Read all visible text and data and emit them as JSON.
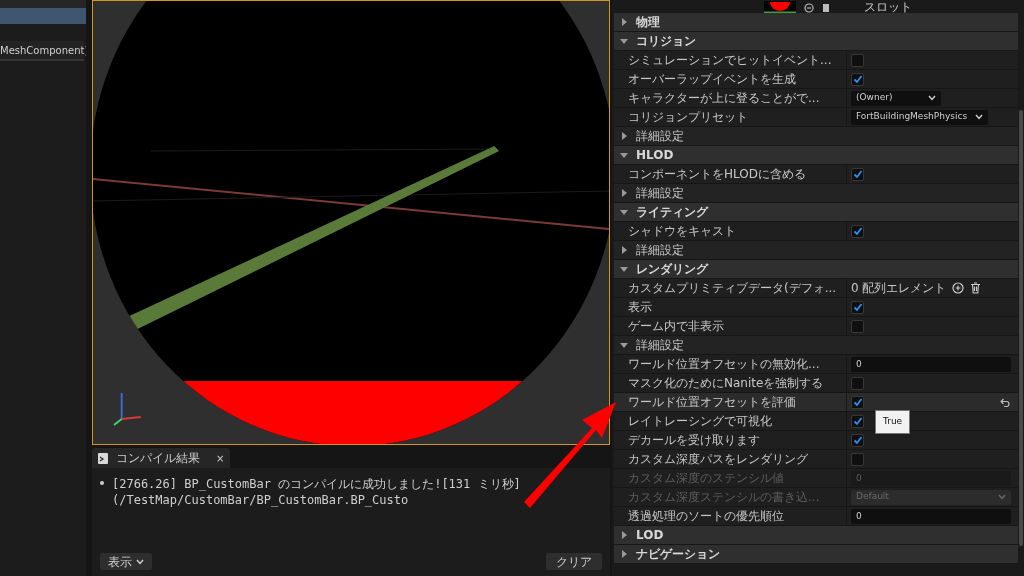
{
  "left_panel": {
    "selected_row": {
      "selected": true
    },
    "item": "MeshComponent)"
  },
  "compile_results": {
    "tab": "コンパイル結果",
    "close": "×",
    "log": [
      "[2766.26] BP_CustomBar のコンパイルに成功しました![131 ミリ秒] (/TestMap/CustomBar/BP_CustomBar.BP_Custo"
    ],
    "show_button": "表示",
    "clear_button": "クリア"
  },
  "details": {
    "slot_label": "スロット",
    "sections": [
      {
        "label": "物理",
        "expanded": false
      },
      {
        "label": "コリジョン",
        "expanded": true,
        "children": [
          {
            "kind": "checkbox",
            "label": "シミュレーションでヒットイベント...",
            "checked": false,
            "hovered": false
          },
          {
            "kind": "checkbox",
            "label": "オーバーラップイベントを生成",
            "checked": true,
            "hovered": false
          },
          {
            "kind": "dropdown",
            "label": "キャラクターが上に登ることがで...",
            "value": "(Owner)",
            "hovered": false
          },
          {
            "kind": "dropdown",
            "label": "コリジョンプリセット",
            "value": "FortBuildingMeshPhysics",
            "hovered": false
          },
          {
            "kind": "group",
            "label": "詳細設定",
            "expanded": false
          }
        ]
      },
      {
        "label": "HLOD",
        "expanded": true,
        "children": [
          {
            "kind": "checkbox",
            "label": "コンポーネントをHLODに含める",
            "checked": true,
            "hovered": false
          },
          {
            "kind": "group",
            "label": "詳細設定",
            "expanded": false
          }
        ]
      },
      {
        "label": "ライティング",
        "expanded": true,
        "children": [
          {
            "kind": "checkbox",
            "label": "シャドウをキャスト",
            "checked": true,
            "hovered": false
          },
          {
            "kind": "group",
            "label": "詳細設定",
            "expanded": false
          }
        ]
      },
      {
        "label": "レンダリング",
        "expanded": true,
        "children": [
          {
            "kind": "array",
            "label": "カスタムプリミティブデータ(デフォ...",
            "value": "0 配列エレメント",
            "hovered": false
          },
          {
            "kind": "checkbox",
            "label": "表示",
            "checked": true,
            "hovered": false
          },
          {
            "kind": "checkbox",
            "label": "ゲーム内で非表示",
            "checked": false,
            "hovered": false
          },
          {
            "kind": "group",
            "label": "詳細設定",
            "expanded": true,
            "children": [
              {
                "kind": "number",
                "label": "ワールド位置オフセットの無効化...",
                "value": "0",
                "disabled": false,
                "hovered": false
              },
              {
                "kind": "checkbox",
                "label": "マスク化のためにNaniteを強制する",
                "checked": false,
                "hovered": false
              },
              {
                "kind": "checkbox",
                "label": "ワールド位置オフセットを評価",
                "checked": true,
                "hovered": true
              },
              {
                "kind": "checkbox",
                "label": "レイトレーシングで可視化",
                "checked": true,
                "hovered": false
              },
              {
                "kind": "checkbox",
                "label": "デカールを受け取ります",
                "checked": true,
                "hovered": false
              },
              {
                "kind": "checkbox",
                "label": "カスタム深度パスをレンダリング",
                "checked": false,
                "hovered": false
              },
              {
                "kind": "number",
                "label": "カスタム深度のステンシル値",
                "value": "0",
                "disabled": true,
                "hovered": false
              },
              {
                "kind": "dropdown",
                "label": "カスタム深度ステンシルの書き込...",
                "value": "Default",
                "disabled": true,
                "hovered": false
              },
              {
                "kind": "number",
                "label": "透過処理のソートの優先順位",
                "value": "0",
                "disabled": false,
                "hovered": false
              }
            ]
          }
        ]
      },
      {
        "label": "LOD",
        "expanded": false
      },
      {
        "label": "ナビゲーション",
        "expanded": false
      }
    ]
  },
  "tooltip": {
    "text": "True"
  }
}
